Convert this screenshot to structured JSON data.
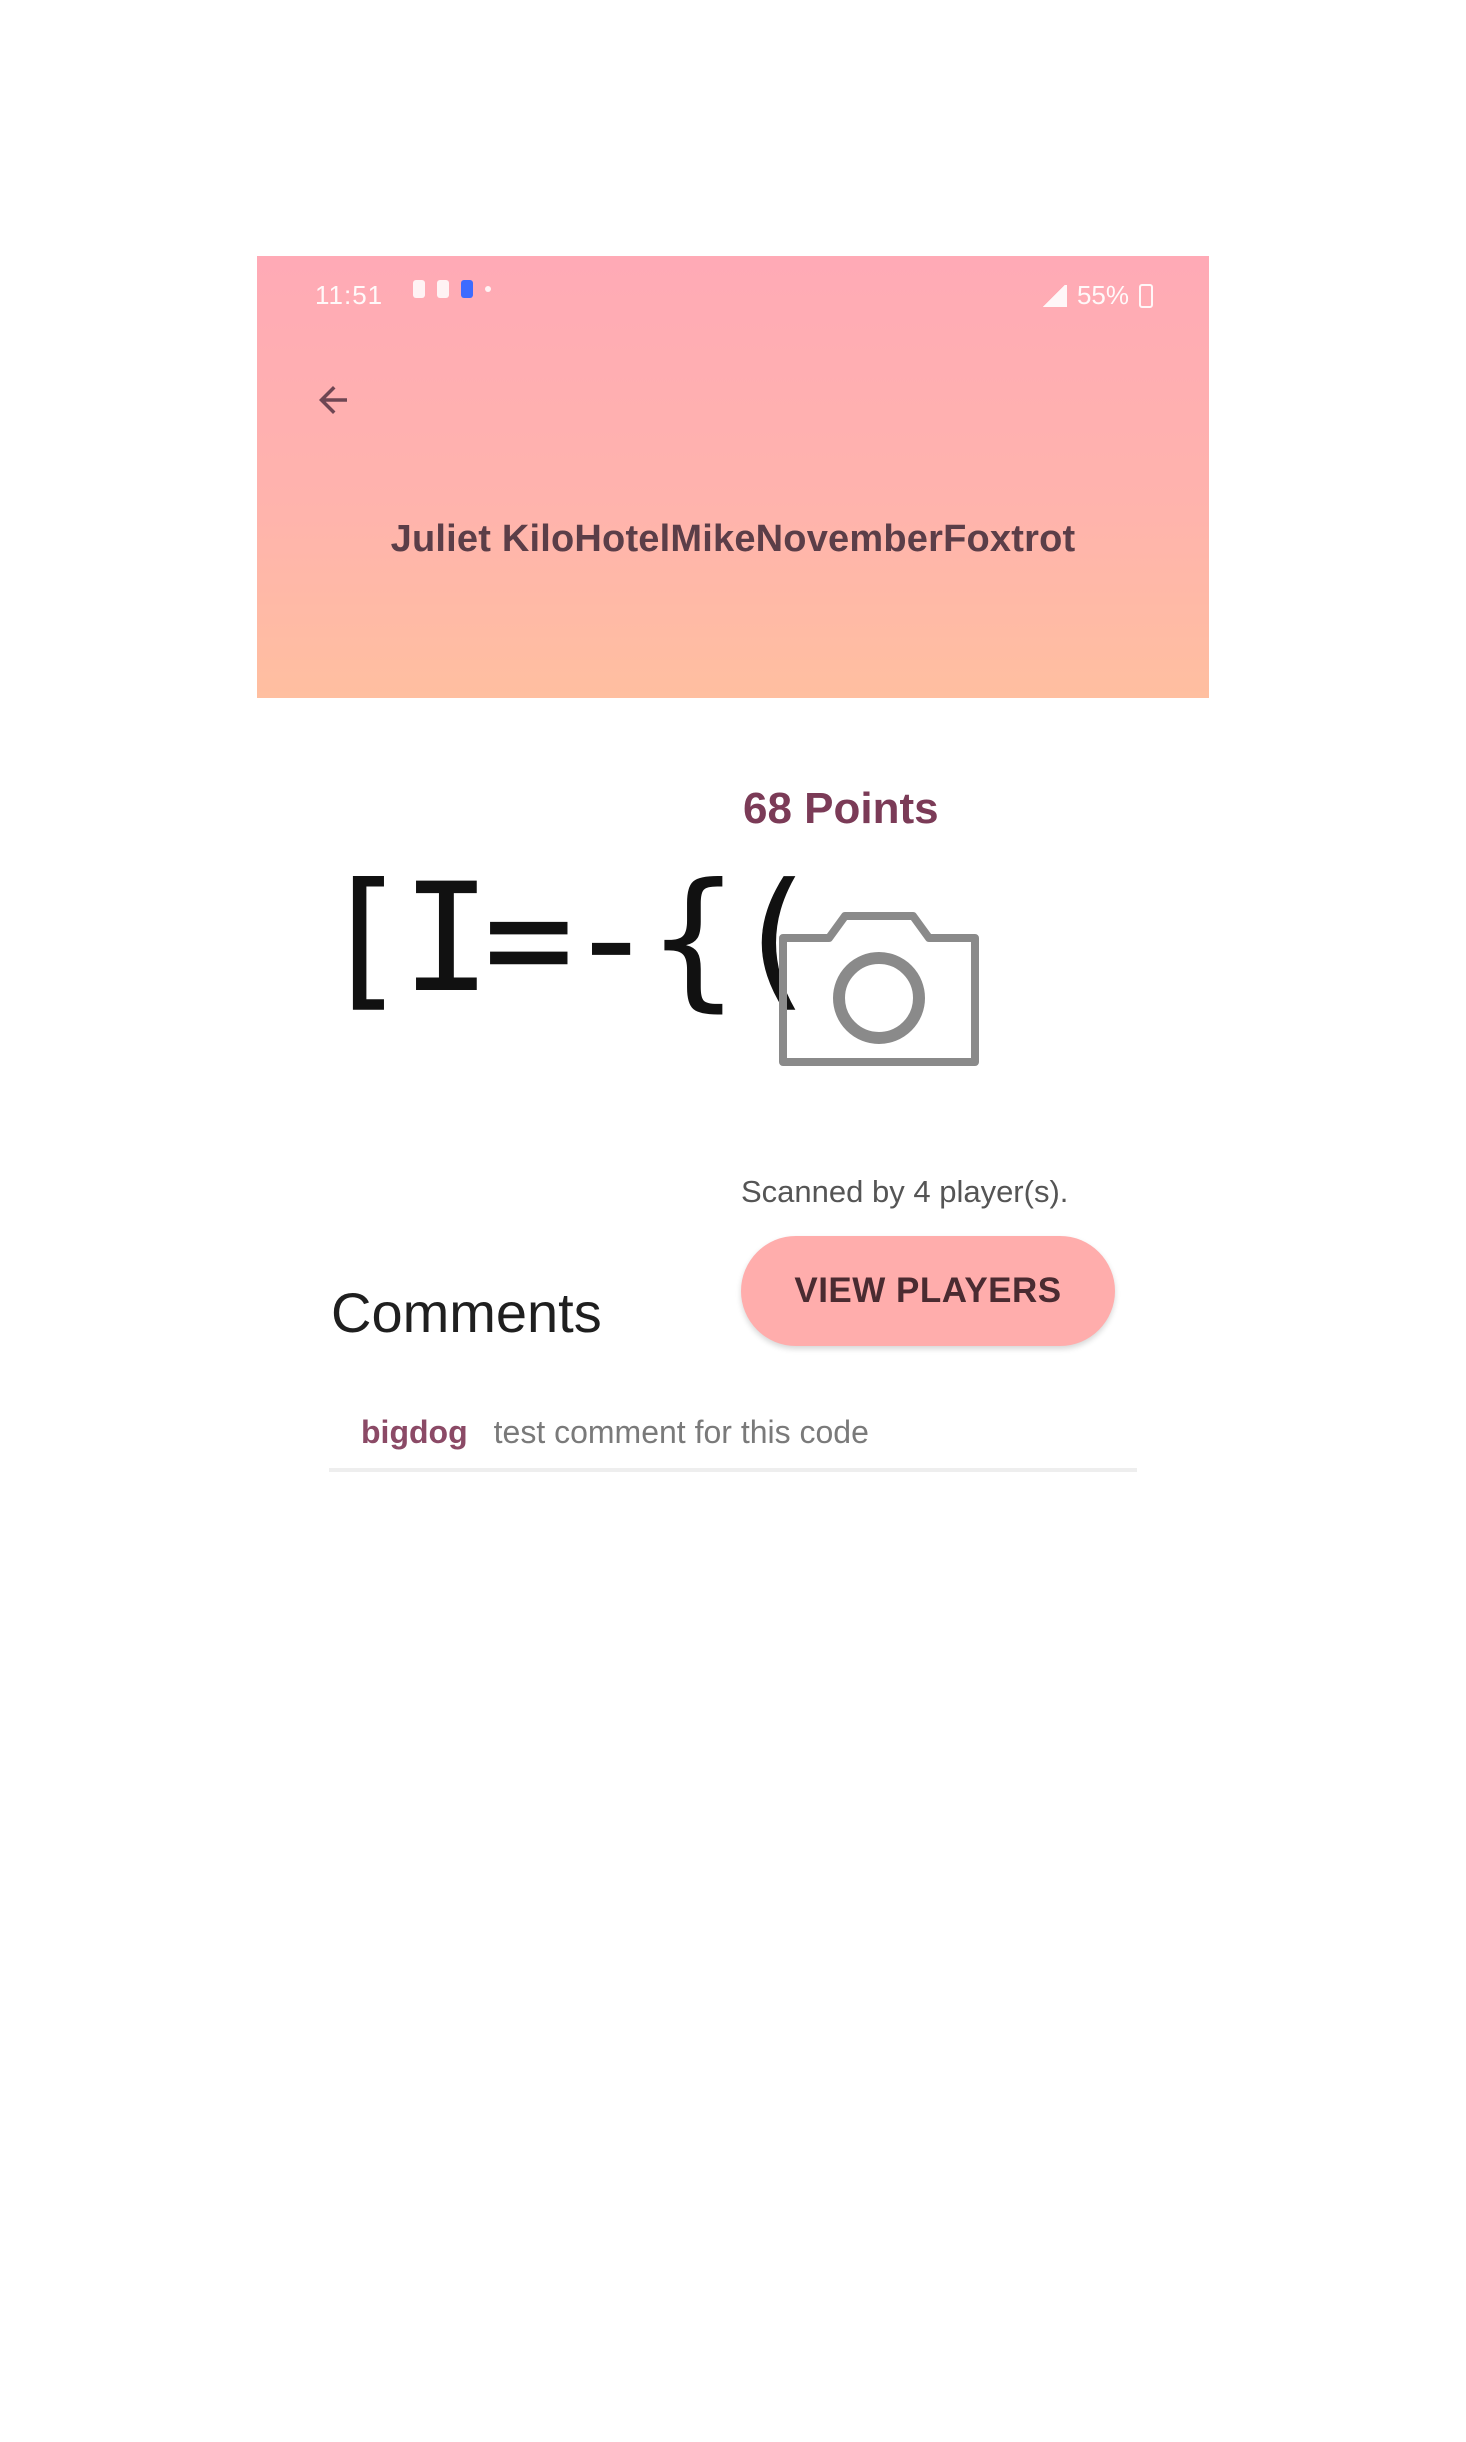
{
  "status_bar": {
    "time": "11:51",
    "battery": "55%"
  },
  "header": {
    "title": "Juliet KiloHotelMikeNovemberFoxtrot",
    "back_icon": "arrow-left-icon",
    "gradient_top": "#ffaab6",
    "gradient_bottom": "#ffbfa0"
  },
  "code": {
    "points_label": "68 Points",
    "visual_text": "[I=-{(",
    "photo_icon": "camera-icon",
    "scanned_text": "Scanned by 4 player(s)."
  },
  "actions": {
    "view_players_label": "VIEW PLAYERS"
  },
  "comments": {
    "title": "Comments",
    "items": [
      {
        "user": "bigdog",
        "text": "test comment for this code"
      }
    ]
  },
  "colors": {
    "accent": "#7b3b57",
    "button_bg": "#ffadac"
  }
}
